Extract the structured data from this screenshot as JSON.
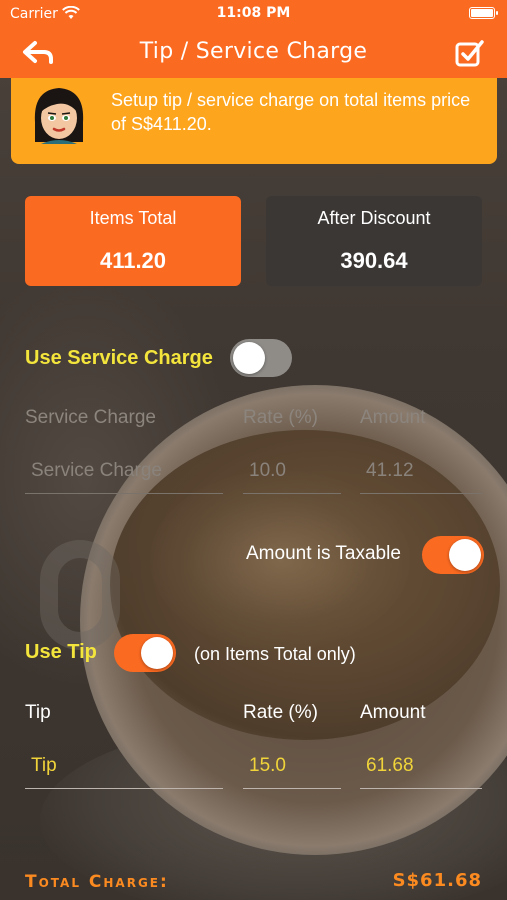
{
  "status_bar": {
    "carrier": "Carrier",
    "time": "11:08 PM"
  },
  "nav": {
    "title": "Tip / Service Charge",
    "back_icon": "back-arrow-icon",
    "done_icon": "checkbox-done-icon"
  },
  "banner": {
    "message": "Setup tip / service charge on total items price of S$411.20."
  },
  "summary": {
    "items_total_label": "Items Total",
    "items_total_value": "411.20",
    "after_discount_label": "After Discount",
    "after_discount_value": "390.64"
  },
  "service_charge": {
    "toggle_label": "Use Service Charge",
    "enabled": false,
    "headers": {
      "name": "Service Charge",
      "rate": "Rate (%)",
      "amount": "Amount"
    },
    "name_placeholder": "Service Charge",
    "rate": "10.0",
    "amount": "41.12",
    "taxable_label": "Amount is Taxable",
    "taxable": true
  },
  "tip": {
    "toggle_label": "Use Tip",
    "enabled": true,
    "note": "(on Items Total only)",
    "headers": {
      "name": "Tip",
      "rate": "Rate (%)",
      "amount": "Amount"
    },
    "name_value": "Tip",
    "rate": "15.0",
    "amount": "61.68"
  },
  "total": {
    "label": "Total Charge:",
    "value": "S$61.68"
  },
  "colors": {
    "accent": "#fb6a21",
    "banner": "#fea51e",
    "highlight_text": "#f4e53c",
    "total_text": "#fb8a20"
  }
}
